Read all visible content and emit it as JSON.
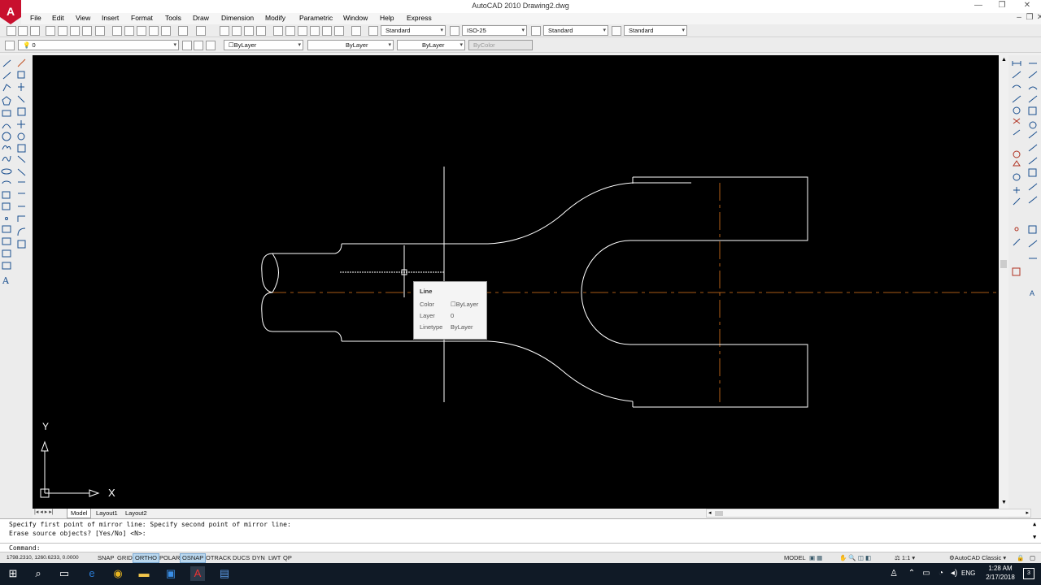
{
  "window": {
    "title": "AutoCAD 2010     Drawing2.dwg",
    "logo": "A",
    "min": "—",
    "max": "❐",
    "close": "✕"
  },
  "menu": [
    "File",
    "Edit",
    "View",
    "Insert",
    "Format",
    "Tools",
    "Draw",
    "Dimension",
    "Modify",
    "Parametric",
    "Window",
    "Help",
    "Express"
  ],
  "styles": {
    "text_style": "Standard",
    "dim_style": "ISO-25",
    "table_style": "Standard",
    "mleader_style": "Standard"
  },
  "layer": {
    "current": "0"
  },
  "properties": {
    "color": "ByLayer",
    "linetype": "ByLayer",
    "lineweight": "ByLayer",
    "plotstyle": "ByColor"
  },
  "tooltip": {
    "title": "Line",
    "rows": [
      {
        "label": "Color",
        "value": "ByLayer"
      },
      {
        "label": "Layer",
        "value": "0"
      },
      {
        "label": "Linetype",
        "value": "ByLayer"
      }
    ]
  },
  "ucs": {
    "x": "X",
    "y": "Y"
  },
  "layout_tabs": [
    "Model",
    "Layout1",
    "Layout2"
  ],
  "command_history": [
    "Specify first point of mirror line: Specify second point of mirror line:",
    "Erase source objects? [Yes/No] <N>:"
  ],
  "command_prompt": "Command:",
  "coords": "1798.2310, 1260.6233, 0.0000",
  "status_toggles": [
    {
      "label": "SNAP",
      "on": false
    },
    {
      "label": "GRID",
      "on": false
    },
    {
      "label": "ORTHO",
      "on": true
    },
    {
      "label": "POLAR",
      "on": false
    },
    {
      "label": "OSNAP",
      "on": true
    },
    {
      "label": "OTRACK",
      "on": false
    },
    {
      "label": "DUCS",
      "on": false
    },
    {
      "label": "DYN",
      "on": false
    },
    {
      "label": "LWT",
      "on": false
    },
    {
      "label": "QP",
      "on": false
    }
  ],
  "status_right": {
    "space": "MODEL",
    "scale": "1:1",
    "workspace": "AutoCAD Classic"
  },
  "taskbar": {
    "lang": "ENG",
    "time": "1:28 AM",
    "date": "2/17/2018",
    "notifications": "3"
  },
  "colors": {
    "canvas": "#000000",
    "geometry": "#ffffff",
    "centerline": "#e0781e",
    "taskbar": "#101a26"
  }
}
